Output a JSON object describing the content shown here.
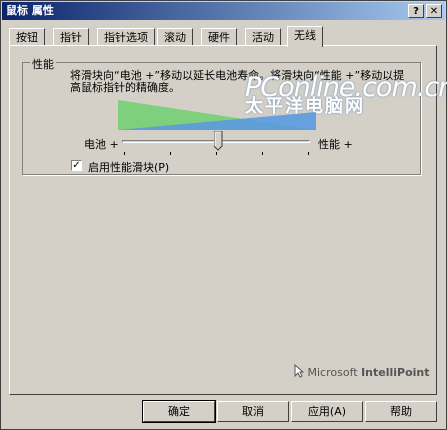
{
  "window": {
    "title": "鼠标 属性",
    "help_glyph": "?",
    "close_glyph": "✕"
  },
  "tabs": [
    {
      "label": "按钮"
    },
    {
      "label": "指针"
    },
    {
      "label": "指针选项"
    },
    {
      "label": "滚动"
    },
    {
      "label": "硬件"
    },
    {
      "label": "活动"
    },
    {
      "label": "无线",
      "active": true
    }
  ],
  "performance": {
    "group_label": "性能",
    "description": "将滑块向“电池 +”移动以延长电池寿命。将滑块向“性能 +”移动以提高鼠标指针的精确度。",
    "left_label": "电池 +",
    "right_label": "性能 +",
    "slider_value_fraction": 0.52,
    "checkbox_checked": true,
    "checkbox_mark": "✓",
    "checkbox_label": "启用性能滑块(P)",
    "graph_colors": {
      "battery": "#7ecf7e",
      "performance": "#5b9ae0"
    }
  },
  "watermark": {
    "brand": "PConline.com.cn",
    "site_cn": "太平洋电脑网"
  },
  "branding": {
    "microsoft": "Microsoft",
    "product": "IntelliPoint"
  },
  "buttons": {
    "ok": "确定",
    "cancel": "取消",
    "apply": "应用(A)",
    "help": "帮助"
  }
}
